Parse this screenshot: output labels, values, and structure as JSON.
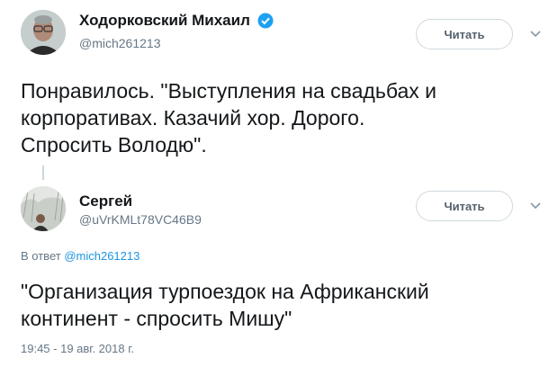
{
  "tweet1": {
    "author_name": "Ходорковский Михаил",
    "handle": "@mich261213",
    "verified": true,
    "follow_label": "Читать",
    "text": "Понравилось. \"Выступления на свадьбах и\nкорпоративах. Казачий хор. Дорого.\nСпросить Володю\"."
  },
  "tweet2": {
    "author_name": "Сергей",
    "handle": "@uVrKMLt78VC46B9",
    "follow_label": "Читать",
    "reply_prefix": "В ответ",
    "reply_handle": "@mich261213",
    "text": "\"Организация турпоездок на Африканский\nконтинент - спросить Мишу\"",
    "timestamp": "19:45 - 19 авг. 2018 г."
  },
  "colors": {
    "verified_badge": "#1da1f2",
    "link": "#1b95e0",
    "secondary_text": "#657786"
  },
  "icons": {
    "verified": "verified-badge-icon",
    "menu": "chevron-down-icon"
  }
}
